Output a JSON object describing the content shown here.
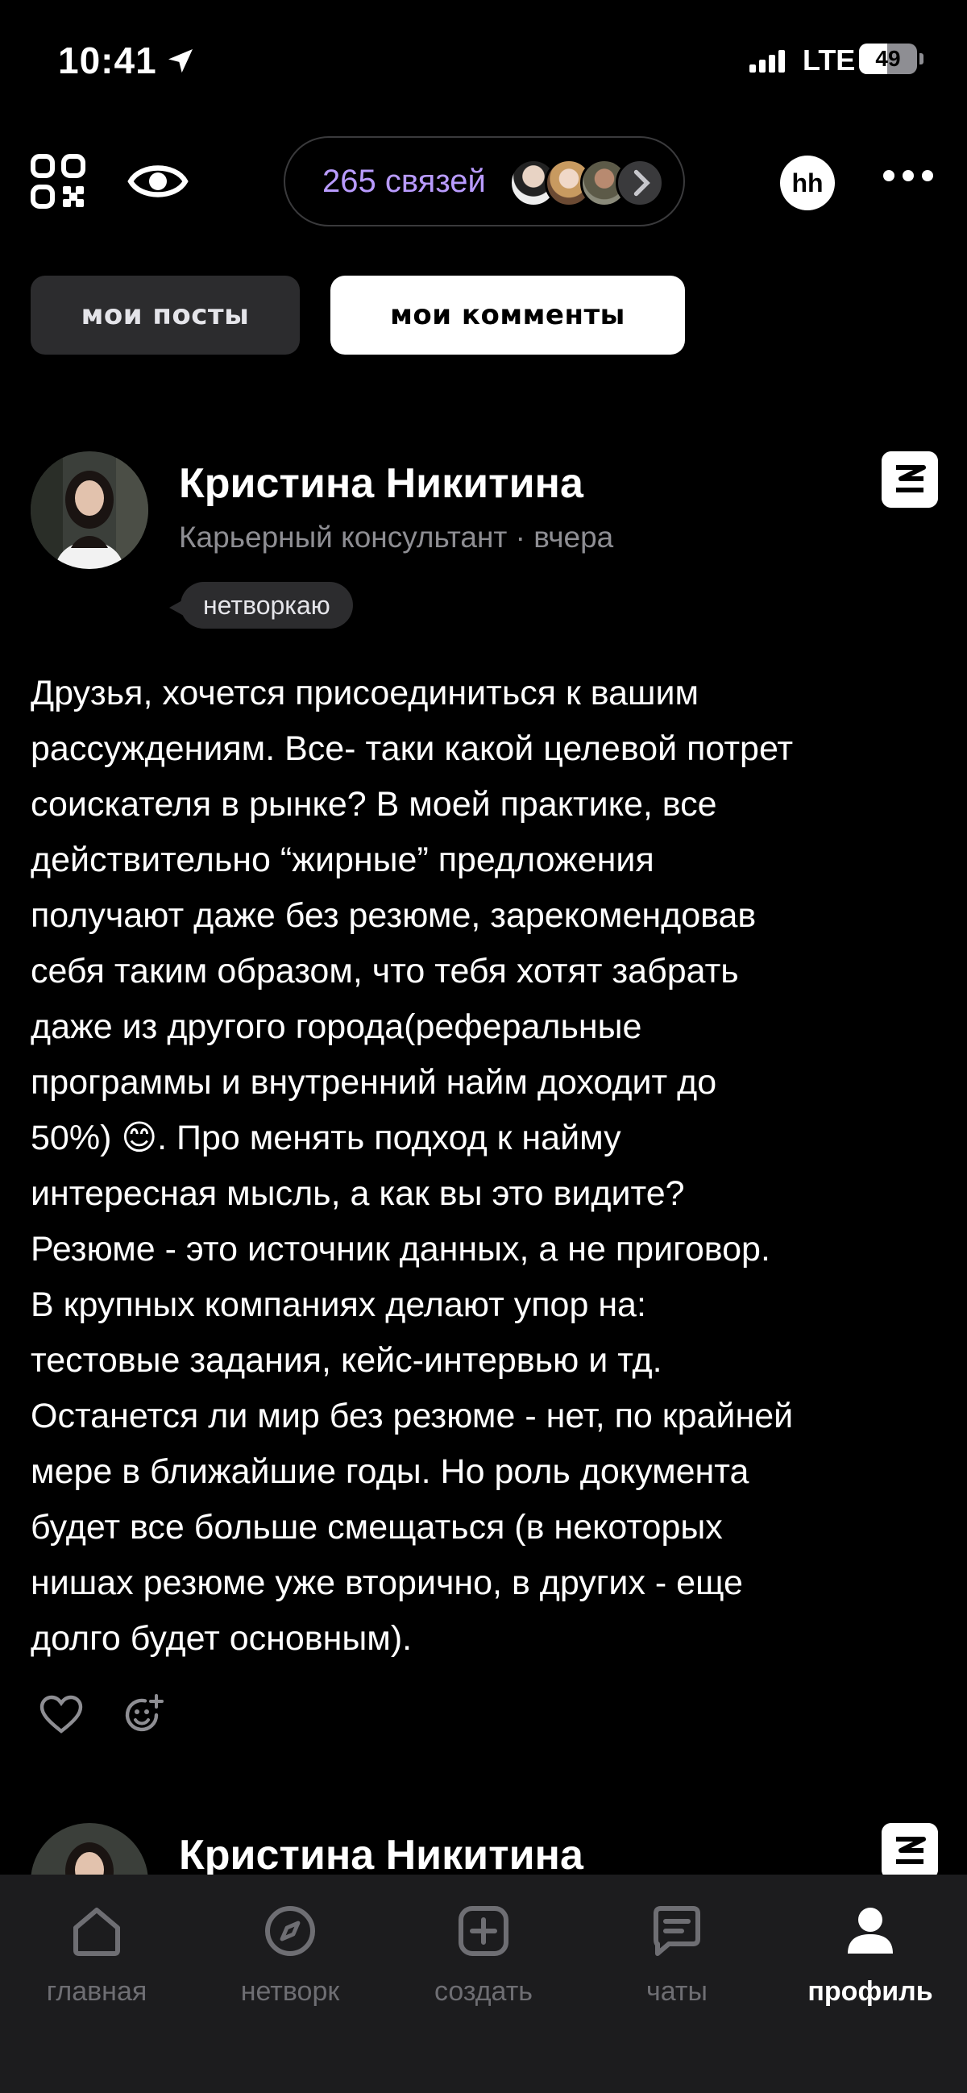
{
  "status_bar": {
    "time": "10:41",
    "network": "LTE",
    "battery": "49",
    "battery_level": 0.49
  },
  "header": {
    "connections_label": "265 связей",
    "hh_label": "hh"
  },
  "tabs": [
    {
      "label": "мои посты",
      "active": false
    },
    {
      "label": "мои комменты",
      "active": true
    }
  ],
  "posts": [
    {
      "author": "Кристина Никитина",
      "meta": "Карьерный консультант · вчера",
      "tag": "нетворкаю",
      "text": "Друзья, хочется присоединиться к вашим\nрассуждениям. Все- таки какой целевой потрет\nсоискателя в рынке? В моей практике, все\nдействительно “жирные” предложения\nполучают даже без резюме, зарекомендовав\nсебя таким образом, что тебя хотят забрать\nдаже из другого города(реферальные\nпрограммы и внутренний найм доходит до\n50%) 😊. Про менять подход к найму\nинтересная мысль, а как вы это видите?\nРезюме - это источник данных, а не приговор.\nВ крупных компаниях делают упор на:\nтестовые задания, кейс-интервью и тд.\nОстанется ли мир без резюме - нет, по крайней\nмере в ближайшие годы. Но роль документа\nбудет все больше смещаться (в некоторых\nнишах резюме уже вторично, в других - еще\nдолго будет основным)."
    },
    {
      "author": "Кристина Никитина"
    }
  ],
  "bottom_nav": [
    {
      "label": "главная",
      "icon": "home-icon",
      "active": false
    },
    {
      "label": "нетворк",
      "icon": "compass-icon",
      "active": false
    },
    {
      "label": "создать",
      "icon": "plus-square-icon",
      "active": false
    },
    {
      "label": "чаты",
      "icon": "chat-icon",
      "active": false
    },
    {
      "label": "профиль",
      "icon": "profile-icon",
      "active": true
    }
  ],
  "colors": {
    "background": "#000000",
    "accent_purple": "#b99bff",
    "tab_inactive": "#2c2c2e",
    "nav_background": "#1c1c1e"
  }
}
